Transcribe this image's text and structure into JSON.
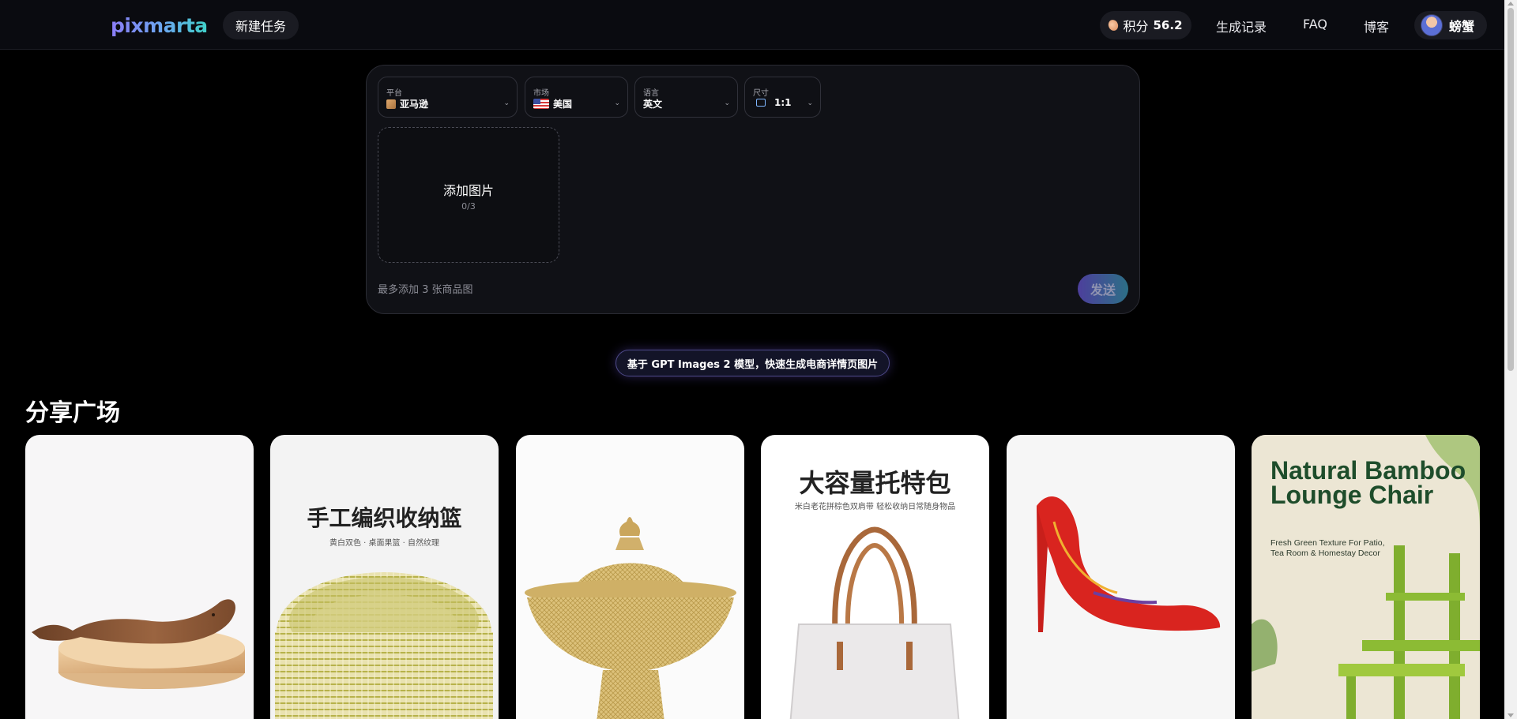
{
  "header": {
    "logo": "pixmarta",
    "new_task": "新建任务",
    "credits_label": "积分",
    "credits_value": "56.2",
    "nav": [
      "生成记录",
      "FAQ",
      "博客"
    ],
    "username": "螃蟹"
  },
  "composer": {
    "selects": [
      {
        "label": "平台",
        "value": "亚马逊",
        "icon": "box-icon"
      },
      {
        "label": "市场",
        "value": "美国",
        "icon": "us-flag-icon"
      },
      {
        "label": "语言",
        "value": "英文",
        "icon": ""
      },
      {
        "label": "尺寸",
        "value": "1:1",
        "icon": "aspect-ratio-icon"
      }
    ],
    "upload_title": "添加图片",
    "upload_count": "0/3",
    "hint": "最多添加 3 张商品图",
    "send": "发送"
  },
  "model_badge": "基于 GPT Images 2 模型，快速生成电商详情页图片",
  "gallery": {
    "title": "分享广场",
    "cards": [
      {
        "title": "",
        "subtitle": ""
      },
      {
        "title": "手工编织收纳篮",
        "subtitle": "黄白双色 · 桌面果篮 · 自然纹理"
      },
      {
        "title": "",
        "subtitle": ""
      },
      {
        "title": "大容量托特包",
        "subtitle": "米白老花拼棕色双肩带 轻松收纳日常随身物品"
      },
      {
        "title": "",
        "subtitle": ""
      },
      {
        "title": "Natural Bamboo Lounge Chair",
        "subtitle": "Fresh Green Texture For Patio, Tea Room & Homestay Decor"
      }
    ]
  },
  "colors": {
    "background": "#000000",
    "accent_purple": "#8b7cf6",
    "accent_teal": "#3fd1c8"
  }
}
